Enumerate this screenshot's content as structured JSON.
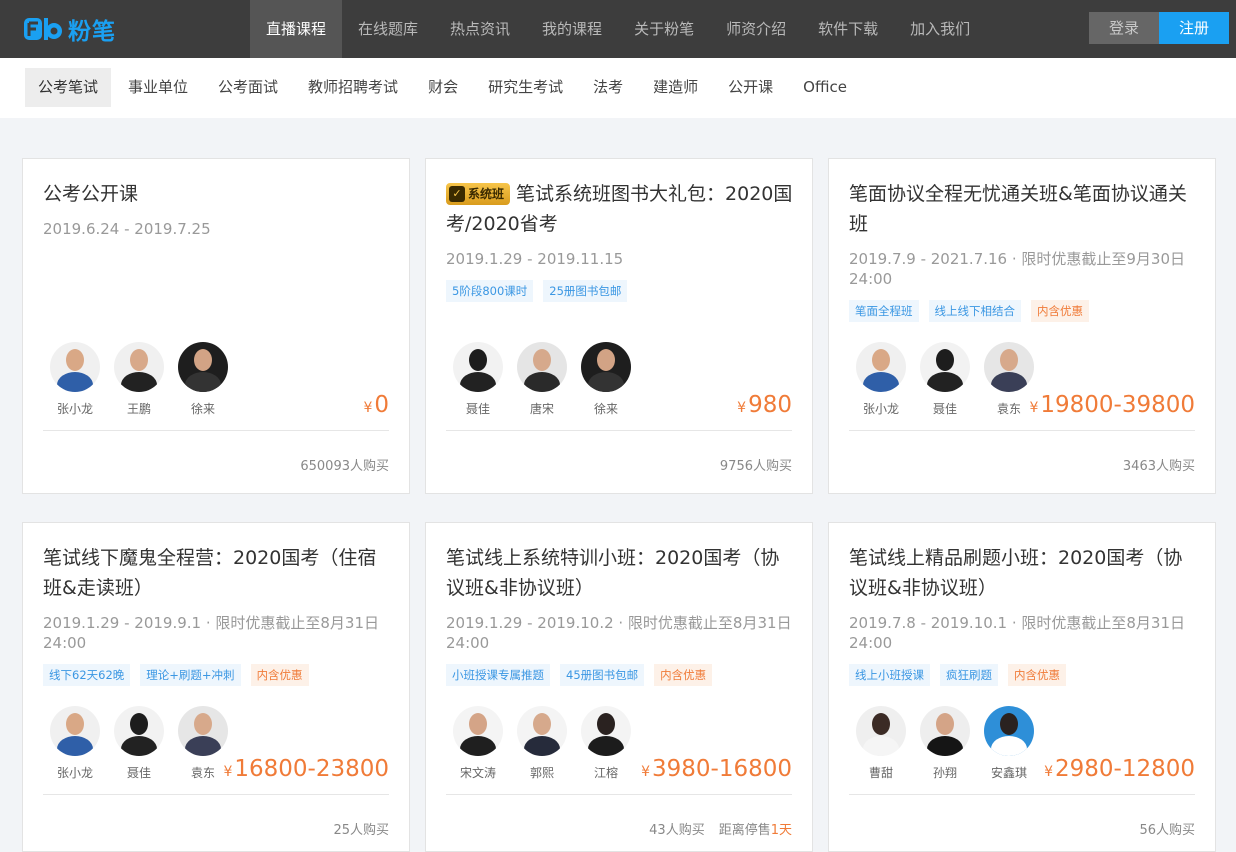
{
  "brand": {
    "logo_text": "粉笔",
    "logo_mark": "Fb"
  },
  "nav": {
    "items": [
      {
        "label": "直播课程",
        "active": true
      },
      {
        "label": "在线题库"
      },
      {
        "label": "热点资讯"
      },
      {
        "label": "我的课程"
      },
      {
        "label": "关于粉笔"
      },
      {
        "label": "师资介绍"
      },
      {
        "label": "软件下载"
      },
      {
        "label": "加入我们"
      }
    ],
    "login_label": "登录",
    "register_label": "注册"
  },
  "categories": [
    {
      "label": "公考笔试",
      "active": true
    },
    {
      "label": "事业单位"
    },
    {
      "label": "公考面试"
    },
    {
      "label": "教师招聘考试"
    },
    {
      "label": "财会"
    },
    {
      "label": "研究生考试"
    },
    {
      "label": "法考"
    },
    {
      "label": "建造师"
    },
    {
      "label": "公开课"
    },
    {
      "label": "Office"
    }
  ],
  "colors": {
    "brand_blue": "#1aa0f2",
    "price_orange": "#f07b38",
    "topbar": "#3d3d3d"
  },
  "currency": "¥",
  "courses": [
    {
      "title": "公考公开课",
      "date": "2019.6.24 - 2019.7.25",
      "tags": [],
      "teachers": [
        "张小龙",
        "王鹏",
        "徐来"
      ],
      "price": "0",
      "bought": "650093人购买"
    },
    {
      "badge": "系统班",
      "title": "笔试系统班图书大礼包：2020国考/2020省考",
      "date": "2019.1.29 - 2019.11.15",
      "tags": [
        {
          "text": "5阶段800课时",
          "color": "blue"
        },
        {
          "text": "25册图书包邮",
          "color": "blue"
        }
      ],
      "teachers": [
        "聂佳",
        "唐宋",
        "徐来"
      ],
      "price": "980",
      "bought": "9756人购买"
    },
    {
      "title": "笔面协议全程无忧通关班&笔面协议通关班",
      "date": "2019.7.9 - 2021.7.16 · 限时优惠截止至9月30日 24:00",
      "tags": [
        {
          "text": "笔面全程班",
          "color": "blue"
        },
        {
          "text": "线上线下相结合",
          "color": "blue"
        },
        {
          "text": "内含优惠",
          "color": "orange"
        }
      ],
      "teachers": [
        "张小龙",
        "聂佳",
        "袁东"
      ],
      "price": "19800-39800",
      "bought": "3463人购买"
    },
    {
      "title": "笔试线下魔鬼全程营：2020国考（住宿班&走读班）",
      "date": "2019.1.29 - 2019.9.1 · 限时优惠截止至8月31日 24:00",
      "tags": [
        {
          "text": "线下62天62晚",
          "color": "blue"
        },
        {
          "text": "理论+刷题+冲刺",
          "color": "blue"
        },
        {
          "text": "内含优惠",
          "color": "orange"
        }
      ],
      "teachers": [
        "张小龙",
        "聂佳",
        "袁东"
      ],
      "price": "16800-23800",
      "bought": "25人购买"
    },
    {
      "title": "笔试线上系统特训小班：2020国考（协议班&非协议班）",
      "date": "2019.1.29 - 2019.10.2 · 限时优惠截止至8月31日 24:00",
      "tags": [
        {
          "text": "小班授课专属推题",
          "color": "blue"
        },
        {
          "text": "45册图书包邮",
          "color": "blue"
        },
        {
          "text": "内含优惠",
          "color": "orange"
        }
      ],
      "teachers": [
        "宋文涛",
        "郭熙",
        "江榕"
      ],
      "price": "3980-16800",
      "bought": "43人购买",
      "countdown_label": "距离停售",
      "countdown_value": "1天"
    },
    {
      "title": "笔试线上精品刷题小班：2020国考（协议班&非协议班）",
      "date": "2019.7.8 - 2019.10.1 · 限时优惠截止至8月31日 24:00",
      "tags": [
        {
          "text": "线上小班授课",
          "color": "blue"
        },
        {
          "text": "疯狂刷题",
          "color": "blue"
        },
        {
          "text": "内含优惠",
          "color": "orange"
        }
      ],
      "teachers": [
        "曹甜",
        "孙翔",
        "安鑫琪"
      ],
      "price": "2980-12800",
      "bought": "56人购买"
    }
  ]
}
